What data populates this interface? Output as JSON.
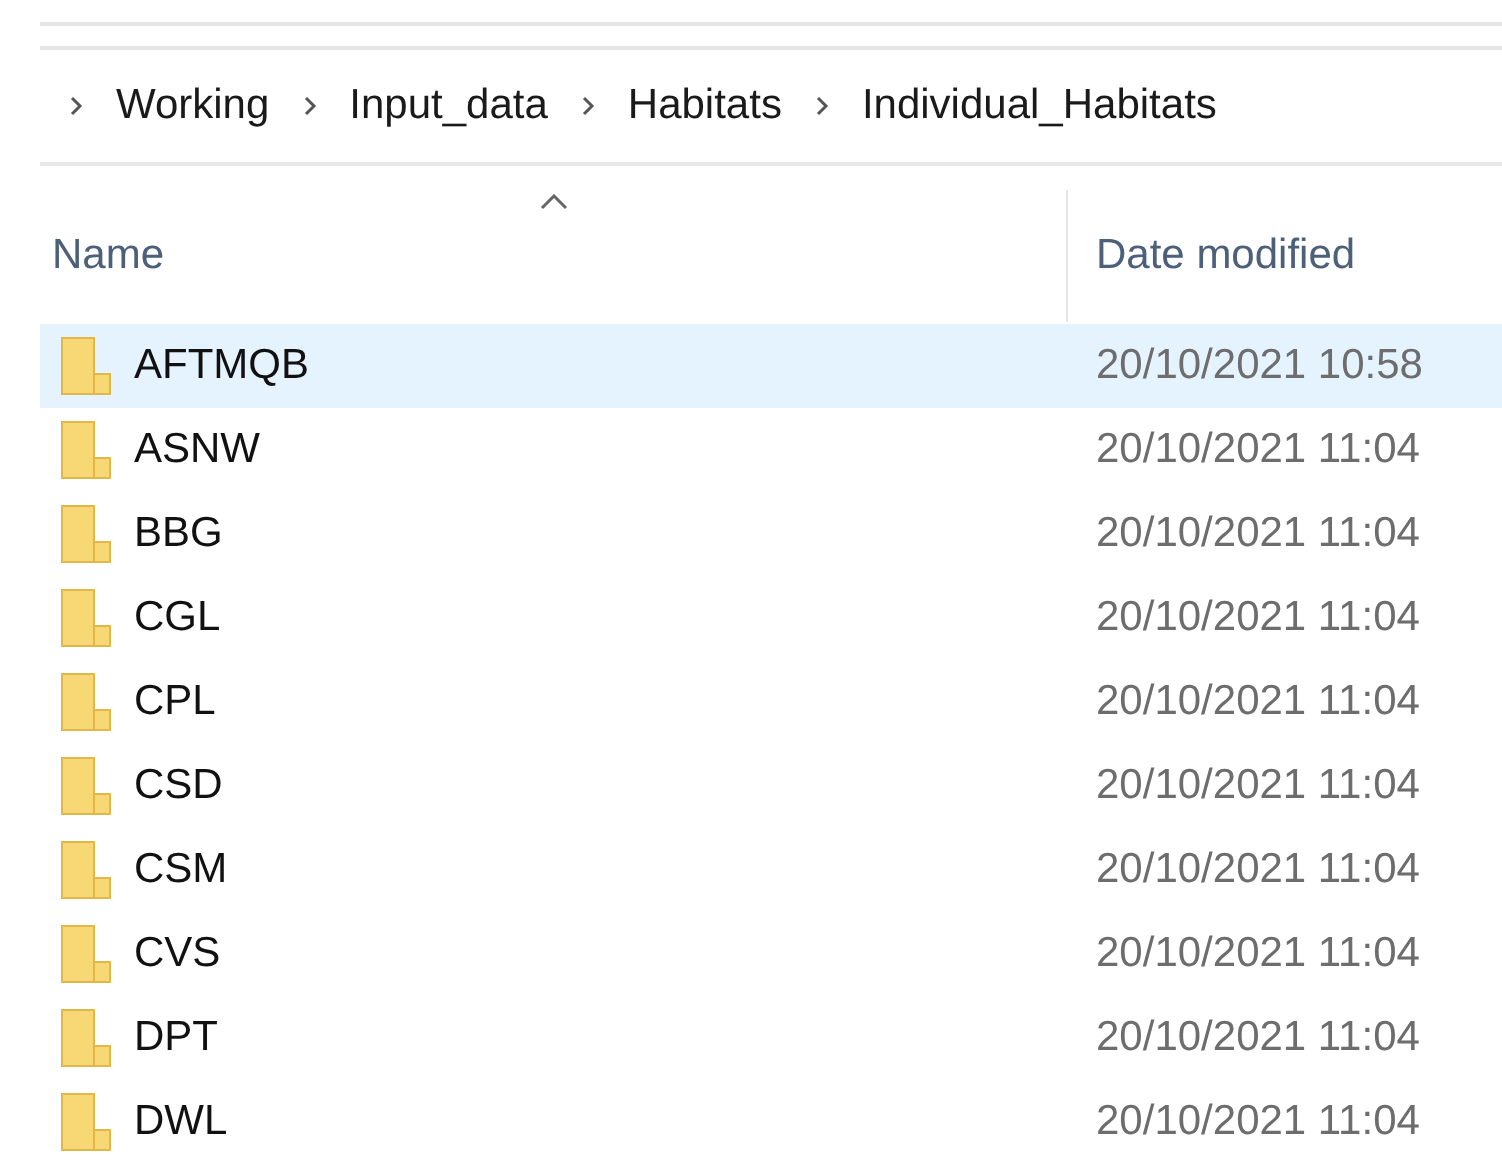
{
  "breadcrumb": [
    "Working",
    "Input_data",
    "Habitats",
    "Individual_Habitats"
  ],
  "columns": [
    {
      "label": "Name",
      "sorted": true
    },
    {
      "label": "Date modified",
      "sorted": false
    }
  ],
  "rows": [
    {
      "name": "AFTMQB",
      "date": "20/10/2021 10:58",
      "selected": true
    },
    {
      "name": "ASNW",
      "date": "20/10/2021 11:04",
      "selected": false
    },
    {
      "name": "BBG",
      "date": "20/10/2021 11:04",
      "selected": false
    },
    {
      "name": "CGL",
      "date": "20/10/2021 11:04",
      "selected": false
    },
    {
      "name": "CPL",
      "date": "20/10/2021 11:04",
      "selected": false
    },
    {
      "name": "CSD",
      "date": "20/10/2021 11:04",
      "selected": false
    },
    {
      "name": "CSM",
      "date": "20/10/2021 11:04",
      "selected": false
    },
    {
      "name": "CVS",
      "date": "20/10/2021 11:04",
      "selected": false
    },
    {
      "name": "DPT",
      "date": "20/10/2021 11:04",
      "selected": false
    },
    {
      "name": "DWL",
      "date": "20/10/2021 11:04",
      "selected": false
    }
  ]
}
